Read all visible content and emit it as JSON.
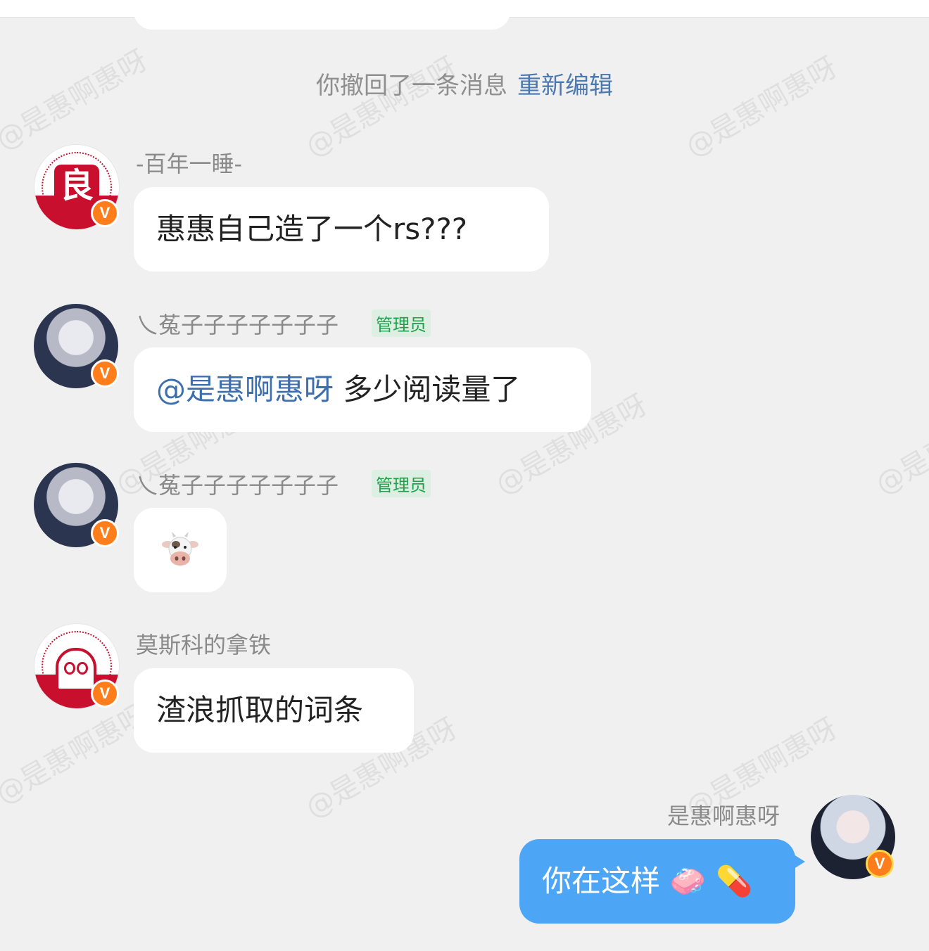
{
  "recall": {
    "text": "你撤回了一条消息",
    "edit_label": "重新编辑"
  },
  "watermark": "@是惠啊惠呀",
  "messages": [
    {
      "sender": "-百年一睡-",
      "text": "惠惠自己造了一个rs???"
    },
    {
      "sender": "乀菟子子子子子子子",
      "badge": "管理员",
      "mention": "@是惠啊惠呀",
      "text": "多少阅读量了"
    },
    {
      "sender": "乀菟子子子子子子子",
      "badge": "管理员",
      "emoji": "cow-face"
    },
    {
      "sender": "莫斯科的拿铁",
      "text": "渣浪抓取的词条"
    },
    {
      "sender": "是惠啊惠呀",
      "text": "你在这样",
      "emoji_1": "🧼",
      "emoji_2": "💊"
    }
  ],
  "avatar_glyph": "良",
  "verified_badge": "V",
  "colors": {
    "accent_blue": "#4ca6f5",
    "mention_blue": "#3d6fae",
    "admin_green": "#1fa24a",
    "verified_orange": "#ff7e1b"
  }
}
